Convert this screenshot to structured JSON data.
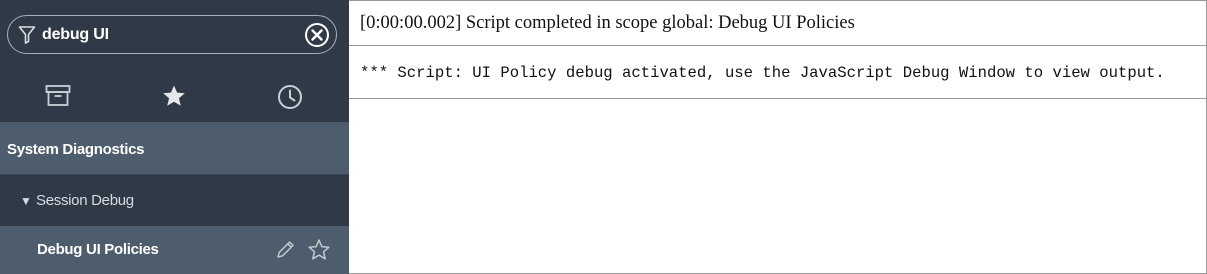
{
  "sidebar": {
    "filter": {
      "value": "debug UI"
    },
    "tabs": [
      {
        "icon": "archive-icon"
      },
      {
        "icon": "star-icon"
      },
      {
        "icon": "clock-icon"
      }
    ],
    "items": [
      {
        "label": "System Diagnostics"
      },
      {
        "label": "Session Debug",
        "caret": "▼"
      },
      {
        "label": "Debug UI Policies"
      }
    ]
  },
  "main": {
    "header": "[0:00:00.002] Script completed in scope global: Debug UI Policies",
    "body": "*** Script: UI Policy debug activated, use the JavaScript Debug Window to view output."
  },
  "colors": {
    "sidebar_bg": "#303a46",
    "selected_row_bg": "#4d5d6d",
    "icon": "#c9d0d6"
  }
}
